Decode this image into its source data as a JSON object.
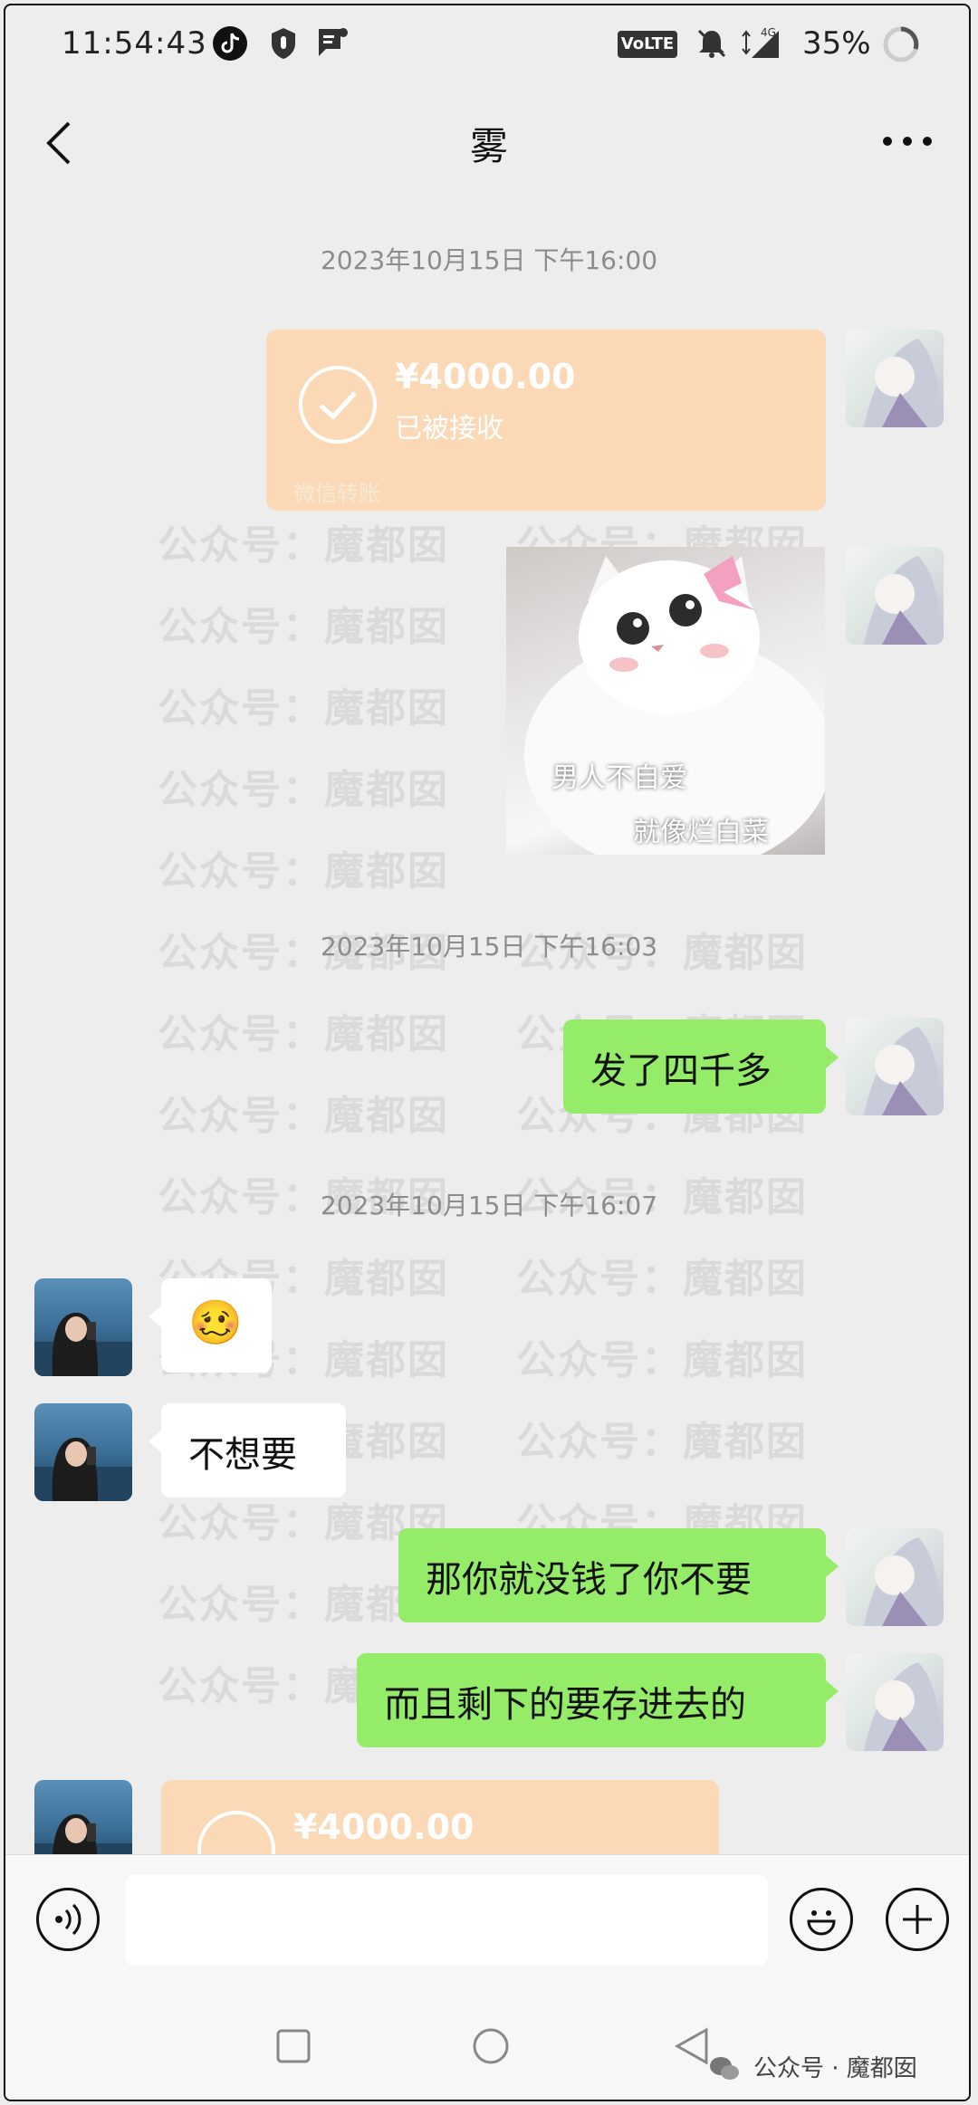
{
  "status_bar": {
    "time": "11:54:43",
    "network_badge": "VoLTE",
    "signal_label": "4G",
    "battery": "35%"
  },
  "header": {
    "title": "雾"
  },
  "messages": {
    "ts1": "2023年10月15日 下午16:00",
    "ts2": "2023年10月15日 下午16:03",
    "ts3": "2023年10月15日 下午16:07",
    "transfer1": {
      "amount": "¥4000.00",
      "status": "已被接收",
      "footer": "微信转账"
    },
    "sticker": {
      "line1": "男人不自爱",
      "line2": "就像烂白菜"
    },
    "msg_fa": "发了四千多",
    "msg_emoji": "🥴",
    "msg_buxiang": "不想要",
    "msg_nani": "那你就没钱了你不要",
    "msg_erqie": "而且剩下的要存进去的",
    "transfer2": {
      "amount": "¥4000.00"
    }
  },
  "watermark": {
    "text": "公众号：魔都囡",
    "footer": "公众号 · 魔都囡"
  },
  "colors": {
    "bubble_green": "#95ec69",
    "transfer_orange": "#fbd9b6",
    "background": "#ededed"
  }
}
